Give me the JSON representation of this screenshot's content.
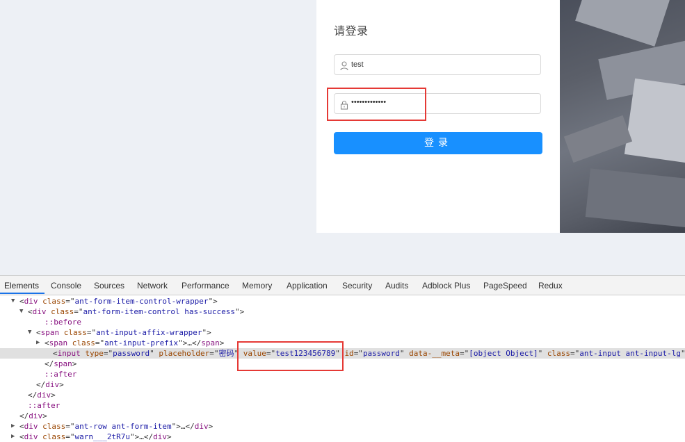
{
  "login": {
    "title": "请登录",
    "username_value": "test",
    "password_masked": "•••••••••••••",
    "submit_label": "登录"
  },
  "devtools": {
    "tabs": [
      "Elements",
      "Console",
      "Sources",
      "Network",
      "Performance",
      "Memory",
      "Application",
      "Security",
      "Audits",
      "Adblock Plus",
      "PageSpeed",
      "Redux"
    ],
    "lines": [
      {
        "tri": "▼",
        "indent": 28,
        "parts": [
          [
            "t",
            "<"
          ],
          [
            "g",
            "div "
          ],
          [
            "a",
            "class"
          ],
          [
            "t",
            "=\""
          ],
          [
            "v",
            "ant-form-item-control-wrapper"
          ],
          [
            "t",
            "\">"
          ]
        ]
      },
      {
        "tri": "▼",
        "indent": 40,
        "parts": [
          [
            "t",
            "<"
          ],
          [
            "g",
            "div "
          ],
          [
            "a",
            "class"
          ],
          [
            "t",
            "=\""
          ],
          [
            "v",
            "ant-form-item-control has-success"
          ],
          [
            "t",
            "\">"
          ]
        ]
      },
      {
        "tri": "",
        "indent": 64,
        "parts": [
          [
            "p",
            "::before"
          ]
        ]
      },
      {
        "tri": "▼",
        "indent": 52,
        "parts": [
          [
            "t",
            "<"
          ],
          [
            "g",
            "span "
          ],
          [
            "a",
            "class"
          ],
          [
            "t",
            "=\""
          ],
          [
            "v",
            "ant-input-affix-wrapper"
          ],
          [
            "t",
            "\">"
          ]
        ]
      },
      {
        "tri": "▶",
        "indent": 64,
        "parts": [
          [
            "t",
            "<"
          ],
          [
            "g",
            "span "
          ],
          [
            "a",
            "class"
          ],
          [
            "t",
            "=\""
          ],
          [
            "v",
            "ant-input-prefix"
          ],
          [
            "t",
            "\">…</"
          ],
          [
            "g",
            "span"
          ],
          [
            "t",
            ">"
          ]
        ]
      },
      {
        "tri": "",
        "indent": 76,
        "selected": true,
        "parts": [
          [
            "t",
            "<"
          ],
          [
            "g",
            "input "
          ],
          [
            "a",
            "type"
          ],
          [
            "t",
            "=\""
          ],
          [
            "v",
            "password"
          ],
          [
            "t",
            "\" "
          ],
          [
            "a",
            "placeholder"
          ],
          [
            "t",
            "=\""
          ],
          [
            "v",
            "密码"
          ],
          [
            "t",
            "\" "
          ],
          [
            "a",
            "value"
          ],
          [
            "t",
            "=\""
          ],
          [
            "v",
            "test123456789"
          ],
          [
            "t",
            "\" "
          ],
          [
            "a",
            "id"
          ],
          [
            "t",
            "=\""
          ],
          [
            "v",
            "password"
          ],
          [
            "t",
            "\" "
          ],
          [
            "a",
            "data-__meta"
          ],
          [
            "t",
            "=\""
          ],
          [
            "v",
            "[object Object]"
          ],
          [
            "t",
            "\" "
          ],
          [
            "a",
            "class"
          ],
          [
            "t",
            "=\""
          ],
          [
            "v",
            "ant-input ant-input-lg"
          ],
          [
            "t",
            "\">"
          ]
        ]
      },
      {
        "tri": "",
        "indent": 64,
        "parts": [
          [
            "t",
            "</"
          ],
          [
            "g",
            "span"
          ],
          [
            "t",
            ">"
          ]
        ]
      },
      {
        "tri": "",
        "indent": 64,
        "parts": [
          [
            "p",
            "::after"
          ]
        ]
      },
      {
        "tri": "",
        "indent": 52,
        "parts": [
          [
            "t",
            "</"
          ],
          [
            "g",
            "div"
          ],
          [
            "t",
            ">"
          ]
        ]
      },
      {
        "tri": "",
        "indent": 40,
        "parts": [
          [
            "t",
            "</"
          ],
          [
            "g",
            "div"
          ],
          [
            "t",
            ">"
          ]
        ]
      },
      {
        "tri": "",
        "indent": 40,
        "parts": [
          [
            "p",
            "::after"
          ]
        ]
      },
      {
        "tri": "",
        "indent": 28,
        "parts": [
          [
            "t",
            "</"
          ],
          [
            "g",
            "div"
          ],
          [
            "t",
            ">"
          ]
        ]
      },
      {
        "tri": "▶",
        "indent": 28,
        "parts": [
          [
            "t",
            "<"
          ],
          [
            "g",
            "div "
          ],
          [
            "a",
            "class"
          ],
          [
            "t",
            "=\""
          ],
          [
            "v",
            "ant-row ant-form-item"
          ],
          [
            "t",
            "\">…</"
          ],
          [
            "g",
            "div"
          ],
          [
            "t",
            ">"
          ]
        ]
      },
      {
        "tri": "▶",
        "indent": 28,
        "parts": [
          [
            "t",
            "<"
          ],
          [
            "g",
            "div "
          ],
          [
            "a",
            "class"
          ],
          [
            "t",
            "=\""
          ],
          [
            "v",
            "warn___2tR7u"
          ],
          [
            "t",
            "\">…</"
          ],
          [
            "g",
            "div"
          ],
          [
            "t",
            ">"
          ]
        ]
      }
    ]
  },
  "colors": {
    "primary": "#1890ff",
    "highlight": "#e53935"
  },
  "icons": {
    "username_prefix": "user-icon",
    "password_prefix": "lock-icon"
  }
}
